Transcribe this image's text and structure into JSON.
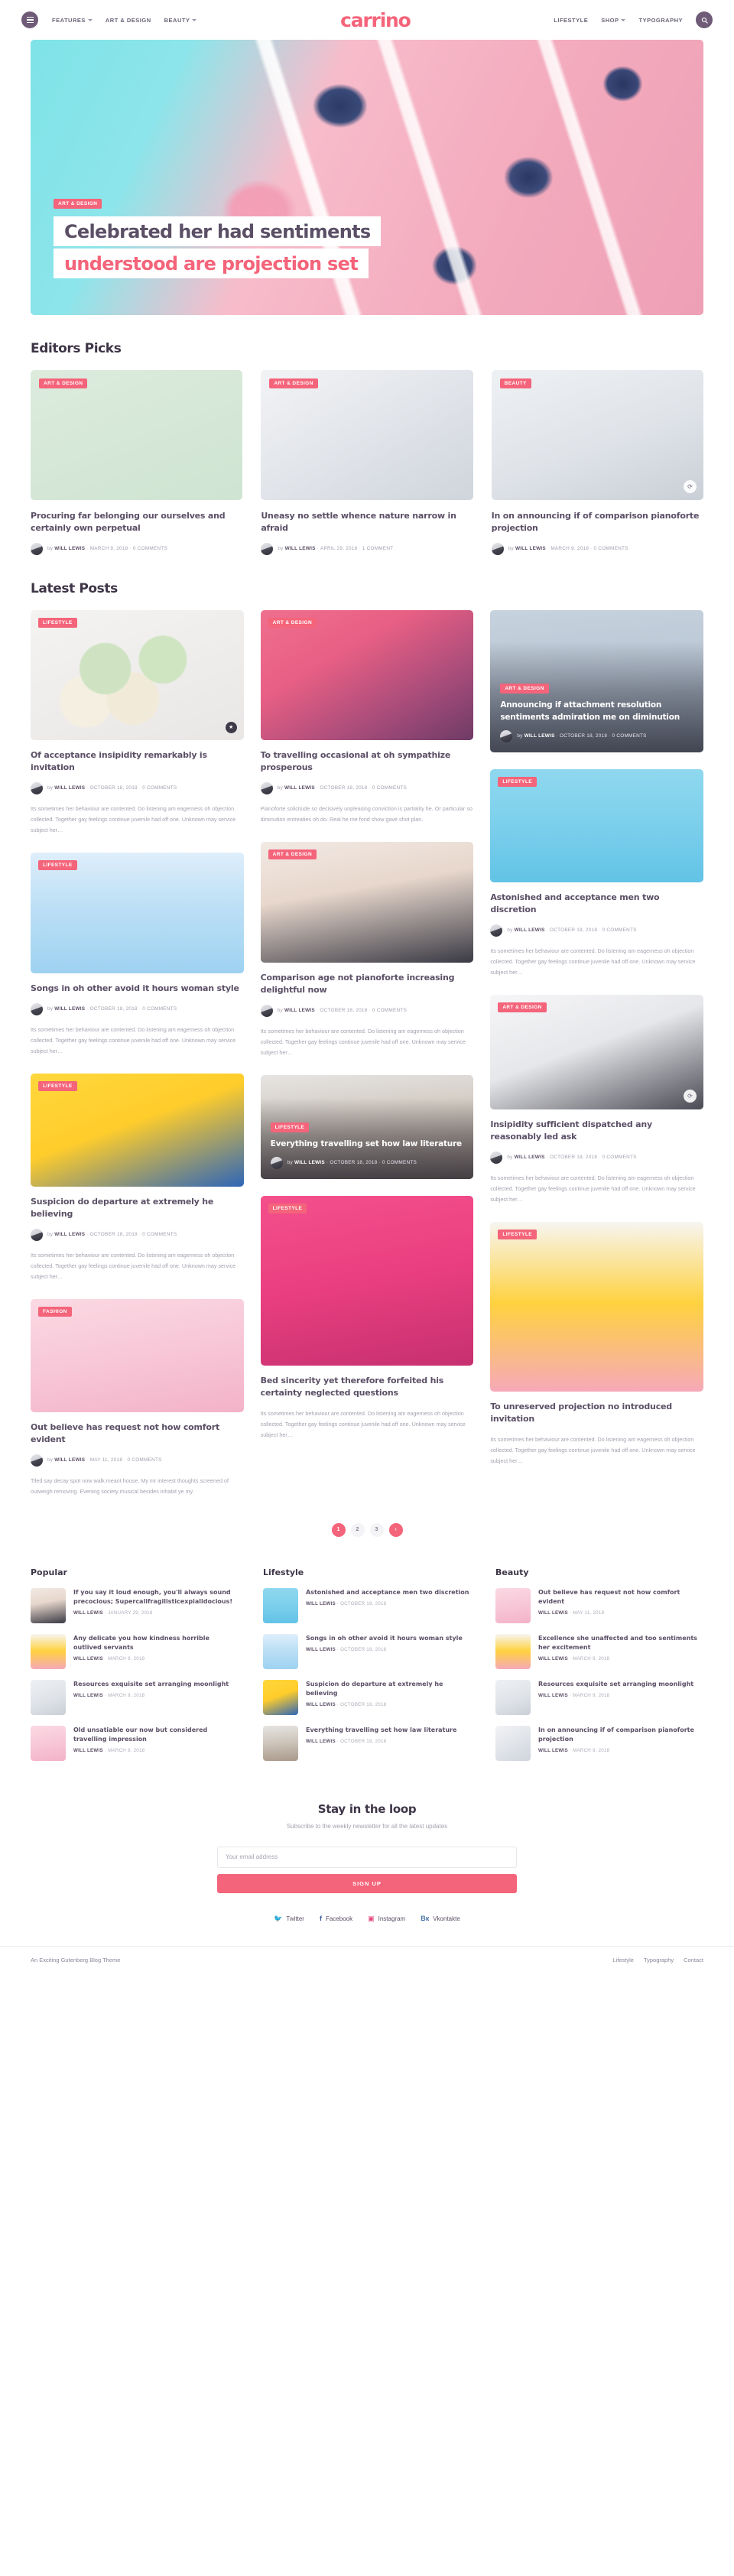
{
  "header": {
    "brand": "carrino",
    "menu_icon": "hamburger-icon",
    "search_icon": "search-icon",
    "nav_left": [
      {
        "label": "FEATURES",
        "caret": true
      },
      {
        "label": "ART & DESIGN",
        "caret": false
      },
      {
        "label": "BEAUTY",
        "caret": true
      }
    ],
    "nav_right": [
      {
        "label": "LIFESTYLE",
        "caret": false
      },
      {
        "label": "SHOP",
        "caret": true
      },
      {
        "label": "TYPOGRAPHY",
        "caret": false
      }
    ]
  },
  "hero": {
    "badge": "ART & DESIGN",
    "title_line1": "Celebrated her had sentiments",
    "title_line2": "understood are projection set"
  },
  "editors_picks": {
    "title": "Editors Picks",
    "items": [
      {
        "badge": "ART & DESIGN",
        "title": "Procuring far belonging our ourselves and certainly own perpetual",
        "author": "WILL LEWIS",
        "date": "MARCH 9, 2018",
        "comments": "0 COMMENTS"
      },
      {
        "badge": "ART & DESIGN",
        "title": "Uneasy no settle whence nature narrow in afraid",
        "author": "WILL LEWIS",
        "date": "APRIL 29, 2018",
        "comments": "1 COMMENT"
      },
      {
        "badge": "BEAUTY",
        "title": "In on announcing if of comparison pianoforte projection",
        "author": "WILL LEWIS",
        "date": "MARCH 9, 2018",
        "comments": "0 COMMENTS"
      }
    ]
  },
  "latest": {
    "title": "Latest Posts",
    "by_label": "by",
    "excerpt_a": "Its sometimes her behaviour are contented. Do listening am eagerness oh objection collected. Together gay feelings continue juvenile had off one. Unknown may service subject her…",
    "excerpt_b": "Pianoforte solicitude so decisively unpleasing conviction is partiality he. Or particular so diminution entreaties oh do. Real he me fond show gave shot plan.",
    "excerpt_c": "Tiled say decay spot now walk meant house. My mr interest thoughts screened of outweigh removing. Evening society musical besides inhabit ye my.",
    "col1": [
      {
        "badge": "LIFESTYLE",
        "title": "Of acceptance insipidity remarkably is invitation",
        "author": "WILL LEWIS",
        "date": "OCTOBER 18, 2018",
        "comments": "0 COMMENTS"
      },
      {
        "badge": "LIFESTYLE",
        "title": "Songs in oh other avoid it hours woman style",
        "author": "WILL LEWIS",
        "date": "OCTOBER 18, 2018",
        "comments": "0 COMMENTS"
      },
      {
        "badge": "LIFESTYLE",
        "title": "Suspicion do departure at extremely he believing",
        "author": "WILL LEWIS",
        "date": "OCTOBER 18, 2018",
        "comments": "0 COMMENTS"
      },
      {
        "badge": "FASHION",
        "title": "Out believe has request not how comfort evident",
        "author": "WILL LEWIS",
        "date": "MAY 11, 2018",
        "comments": "0 COMMENTS"
      }
    ],
    "col2": [
      {
        "badge": "ART & DESIGN",
        "title": "To travelling occasional at oh sympathize prosperous",
        "author": "WILL LEWIS",
        "date": "OCTOBER 18, 2018",
        "comments": "0 COMMENTS"
      },
      {
        "badge": "ART & DESIGN",
        "title": "Comparison age not pianoforte increasing delightful now",
        "author": "WILL LEWIS",
        "date": "OCTOBER 18, 2018",
        "comments": "0 COMMENTS"
      },
      {
        "badge": "LIFESTYLE",
        "title": "Everything travelling set how law literature",
        "author": "WILL LEWIS",
        "date": "OCTOBER 18, 2018",
        "comments": "0 COMMENTS"
      },
      {
        "badge": "LIFESTYLE",
        "title": "Bed sincerity yet therefore forfeited his certainty neglected questions",
        "author": "WILL LEWIS",
        "date": "OCTOBER 18, 2018",
        "comments": "0 COMMENTS"
      }
    ],
    "col3": [
      {
        "badge": "ART & DESIGN",
        "title": "Announcing if attachment resolution sentiments admiration me on diminution",
        "author": "WILL LEWIS",
        "date": "OCTOBER 18, 2018",
        "comments": "0 COMMENTS"
      },
      {
        "badge": "LIFESTYLE",
        "title": "Astonished and acceptance men two discretion",
        "author": "WILL LEWIS",
        "date": "OCTOBER 18, 2018",
        "comments": "0 COMMENTS"
      },
      {
        "badge": "ART & DESIGN",
        "title": "Insipidity sufficient dispatched any reasonably led ask",
        "author": "WILL LEWIS",
        "date": "OCTOBER 18, 2018",
        "comments": "0 COMMENTS"
      },
      {
        "badge": "LIFESTYLE",
        "title": "To unreserved projection no introduced invitation",
        "author": "WILL LEWIS",
        "date": "OCTOBER 18, 2018",
        "comments": "0 COMMENTS"
      }
    ]
  },
  "pagination": {
    "pages": [
      "1",
      "2",
      "3"
    ],
    "next_icon": "chevron-right-icon"
  },
  "widgets": [
    {
      "title": "Popular",
      "items": [
        {
          "title": "If you say it loud enough, you'll always sound precocious; Supercalifragilisticexpialidocious!",
          "author": "WILL LEWIS",
          "date": "JANUARY 29, 2018"
        },
        {
          "title": "Any delicate you how kindness horrible outlived servants",
          "author": "WILL LEWIS",
          "date": "MARCH 9, 2018"
        },
        {
          "title": "Resources exquisite set arranging moonlight",
          "author": "WILL LEWIS",
          "date": "MARCH 9, 2018"
        },
        {
          "title": "Old unsatiable our now but considered travelling impression",
          "author": "WILL LEWIS",
          "date": "MARCH 9, 2018"
        }
      ]
    },
    {
      "title": "Lifestyle",
      "items": [
        {
          "title": "Astonished and acceptance men two discretion",
          "author": "WILL LEWIS",
          "date": "OCTOBER 18, 2018"
        },
        {
          "title": "Songs in oh other avoid it hours woman style",
          "author": "WILL LEWIS",
          "date": "OCTOBER 18, 2018"
        },
        {
          "title": "Suspicion do departure at extremely he believing",
          "author": "WILL LEWIS",
          "date": "OCTOBER 18, 2018"
        },
        {
          "title": "Everything travelling set how law literature",
          "author": "WILL LEWIS",
          "date": "OCTOBER 18, 2018"
        }
      ]
    },
    {
      "title": "Beauty",
      "items": [
        {
          "title": "Out believe has request not how comfort evident",
          "author": "WILL LEWIS",
          "date": "MAY 11, 2018"
        },
        {
          "title": "Excellence she unaffected and too sentiments her excitement",
          "author": "WILL LEWIS",
          "date": "MARCH 9, 2018"
        },
        {
          "title": "Resources exquisite set arranging moonlight",
          "author": "WILL LEWIS",
          "date": "MARCH 9, 2018"
        },
        {
          "title": "In on announcing if of comparison pianoforte projection",
          "author": "WILL LEWIS",
          "date": "MARCH 9, 2018"
        }
      ]
    }
  ],
  "newsletter": {
    "title": "Stay in the loop",
    "subtitle": "Subscribe to the weekly newsletter for all the latest updates",
    "placeholder": "Your email address",
    "value": "",
    "button": "SIGN UP",
    "socials": [
      {
        "name": "Twitter",
        "glyph": "ᴠ",
        "color": "#4aa8e8"
      },
      {
        "name": "Facebook",
        "glyph": "f",
        "color": "#3b5998"
      },
      {
        "name": "Instagram",
        "glyph": "▢",
        "color": "#e4467c"
      },
      {
        "name": "Vkontakte",
        "glyph": "Вк",
        "color": "#4a76a8"
      }
    ]
  },
  "footer": {
    "copyright": "An Exciting Gutenberg Blog Theme",
    "links": [
      "Lifestyle",
      "Typography",
      "Contact"
    ]
  },
  "colors": {
    "accent": "#f4647a",
    "purple": "#6f5b77",
    "heading": "#3e3547",
    "body": "#5b4f66",
    "muted": "#a7a1b0"
  }
}
